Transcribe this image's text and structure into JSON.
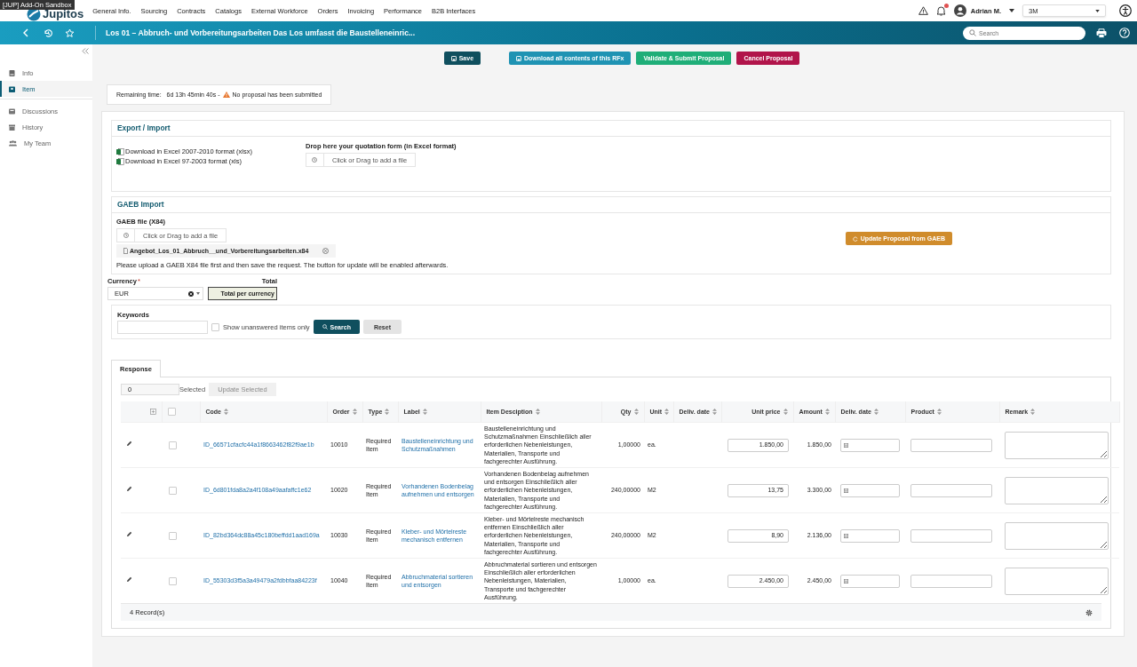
{
  "env_badge": "[JUP] Add-On Sandbox",
  "logo": "Jupitos",
  "nav": [
    "General Info.",
    "Sourcing",
    "Contracts",
    "Catalogs",
    "External Workforce",
    "Orders",
    "Invoicing",
    "Performance",
    "B2B Interfaces"
  ],
  "notifications": {
    "unread": true
  },
  "user": {
    "name": "Adrian M."
  },
  "company": {
    "value": "3M"
  },
  "header": {
    "title": "Los 01 – Abbruch- und Vorbereitungsarbeiten Das Los umfasst die Baustelleneinric...",
    "search": {
      "placeholder": "Search"
    }
  },
  "sidebar": {
    "items": [
      {
        "label": "Info",
        "selected": false
      },
      {
        "label": "Item",
        "selected": true
      },
      {
        "label": "Discussions",
        "selected": false
      },
      {
        "label": "History",
        "selected": false
      },
      {
        "label": "My Team",
        "selected": false
      }
    ]
  },
  "actions": [
    {
      "label": "Save",
      "kind": "save"
    },
    {
      "label": "Download all contents of this RFx",
      "kind": "download"
    },
    {
      "label": "Validate & Submit Proposal",
      "kind": "submit"
    },
    {
      "label": "Cancel Proposal",
      "kind": "cancel"
    }
  ],
  "status": {
    "label": "Remaining time:",
    "time": "6d 13h 45min 40s -",
    "warning": "No proposal has been submitted"
  },
  "export": {
    "title": "Export / Import",
    "links": [
      "Download in Excel 2007-2010 format (xlsx)",
      "Download in Excel 97-2003 format (xls)"
    ],
    "drop_label": "Drop here your quotation form (in Excel format)",
    "drop_placeholder": "Click or Drag to add a file"
  },
  "gaeb": {
    "title": "GAEB Import",
    "file_label": "GAEB file (X84)",
    "drop_placeholder": "Click or Drag to add a file",
    "file_name": "Angebot_Los_01_Abbruch__und_Vorbereitungsarbeiten.x84",
    "note": "Please upload a GAEB X84 file first and then save the request. The button for update will be enabled afterwards.",
    "update_button": "Update Proposal from GAEB"
  },
  "currency": {
    "label": "Currency",
    "required_mark": "*",
    "value": "EUR",
    "total_label": "Total",
    "total_value": "Total per currency"
  },
  "filter": {
    "keywords_label": "Keywords",
    "unanswered": {
      "label": "Show unanswered items only",
      "checked": false
    },
    "search": "Search",
    "reset": "Reset"
  },
  "tabs": [
    {
      "label": "Response",
      "selected": true
    }
  ],
  "selection": {
    "count": "0",
    "label": "Selected",
    "update": {
      "label": "Update Selected",
      "disabled": true
    }
  },
  "table": {
    "select_all": {
      "checked": false
    },
    "columns": [
      "Code",
      "Order",
      "Type",
      "Label",
      "Item Desciption",
      "Qty",
      "Unit",
      "Deliv. date",
      "Unit price",
      "Amount",
      "Deliv. date",
      "Product",
      "Remark"
    ],
    "rows": [
      {
        "checked": false,
        "code": "ID_66571cfacfc44a1f8663462f82f9ae1b",
        "order": "10010",
        "type": "Required Item",
        "label": "Baustelleneinrichtung und Schutzmaßnahmen",
        "description": "Baustelleneinrichtung und Schutzmaßnahmen Einschließlich aller erforderlichen Nebenleistungen, Materialien, Transporte und fachgerechter Ausführung.",
        "qty": "1,00000",
        "unit": "ea.",
        "unit_price": "1.850,00",
        "amount": "1.850,00"
      },
      {
        "checked": false,
        "code": "ID_6d801fda8a2a4f108a49aafaffc1e62",
        "order": "10020",
        "type": "Required Item",
        "label": "Vorhandenen Bodenbelag aufnehmen und entsorgen",
        "description": "Vorhandenen Bodenbelag aufnehmen und entsorgen Einschließlich aller erforderlichen Nebenleistungen, Materialien, Transporte und fachgerechter Ausführung.",
        "qty": "240,00000",
        "unit": "M2",
        "unit_price": "13,75",
        "amount": "3.300,00"
      },
      {
        "checked": false,
        "code": "ID_82bd364dc88a45c180beffdd1aad169a",
        "order": "10030",
        "type": "Required Item",
        "label": "Kleber- und Mörtelreste mechanisch entfernen",
        "description": "Kleber- und Mörtelreste mechanisch entfernen Einschließlich aller erforderlichen Nebenleistungen, Materialien, Transporte und fachgerechter Ausführung.",
        "qty": "240,00000",
        "unit": "M2",
        "unit_price": "8,90",
        "amount": "2.136,00"
      },
      {
        "checked": false,
        "code": "ID_55303d3f5a3a49479a2fdbbfaa84223f",
        "order": "10040",
        "type": "Required Item",
        "label": "Abbruchmaterial sortieren und entsorgen",
        "description": "Abbruchmaterial sortieren und entsorgen Einschließlich aller erforderlichen Nebenleistungen, Materialien, Transporte und fachgerechter Ausführung.",
        "qty": "1,00000",
        "unit": "ea.",
        "unit_price": "2.450,00",
        "amount": "2.450,00"
      }
    ],
    "footer": "4 Record(s)"
  }
}
